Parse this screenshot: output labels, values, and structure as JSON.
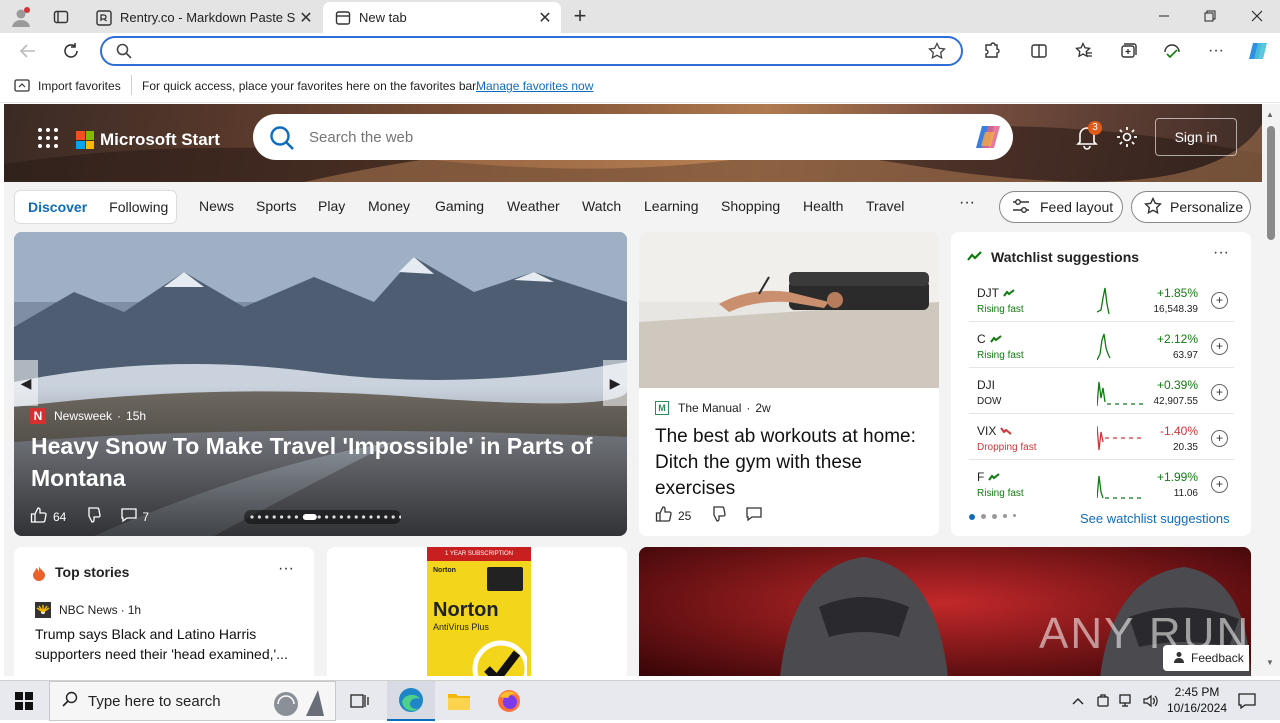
{
  "browser": {
    "tabs": [
      {
        "title": "Rentry.co - Markdown Paste Serv",
        "active": false
      },
      {
        "title": "New tab",
        "active": true
      }
    ],
    "address": {
      "value": "",
      "placeholder": ""
    },
    "favorites_bar": {
      "import_label": "Import favorites",
      "message": "For quick access, place your favorites here on the favorites bar.",
      "manage_link": "Manage favorites now"
    }
  },
  "msstart": {
    "logo_text": "Microsoft Start",
    "search_placeholder": "Search the web",
    "notification_count": "3",
    "sign_in": "Sign in",
    "discover": "Discover",
    "following": "Following",
    "nav": [
      "News",
      "Sports",
      "Play",
      "Money",
      "Gaming",
      "Weather",
      "Watch",
      "Learning",
      "Shopping",
      "Health",
      "Travel"
    ],
    "more": "···",
    "feed_layout": "Feed layout",
    "personalize": "Personalize"
  },
  "hero": {
    "source": "Newsweek",
    "time": "15h",
    "title": "Heavy Snow To Make Travel 'Impossible' in Parts of Montana",
    "likes": "64",
    "comments": "7"
  },
  "side_article": {
    "source": "The Manual",
    "time": "2w",
    "title": "The best ab workouts at home: Ditch the gym with these exercises",
    "likes": "25"
  },
  "watchlist": {
    "title": "Watchlist suggestions",
    "more": "···",
    "see_all": "See watchlist suggestions",
    "stocks": [
      {
        "symbol": "DJT",
        "status": "Rising fast",
        "change": "+1.85%",
        "price": "16,548.39",
        "dir": "up"
      },
      {
        "symbol": "C",
        "status": "Rising fast",
        "change": "+2.12%",
        "price": "63.97",
        "dir": "up"
      },
      {
        "symbol": "DJI",
        "status": "DOW",
        "change": "+0.39%",
        "price": "42,907.55",
        "dir": "up"
      },
      {
        "symbol": "VIX",
        "status": "Dropping fast",
        "change": "-1.40%",
        "price": "20.35",
        "dir": "down"
      },
      {
        "symbol": "F",
        "status": "Rising fast",
        "change": "+1.99%",
        "price": "11.06",
        "dir": "up"
      }
    ]
  },
  "top_stories": {
    "title": "Top stories",
    "source": "NBC News",
    "time": "1h",
    "headline": "Trump says Black and Latino Harris supporters need their 'head examined,'..."
  },
  "ad": {
    "brand": "Norton",
    "product": "AntiVirus Plus",
    "banner": "1 YEAR SUBSCRIPTION"
  },
  "promo": {
    "watermark": "ANY RUN",
    "feedback": "Feedback"
  },
  "taskbar": {
    "search_placeholder": "Type here to search",
    "time": "2:45 PM",
    "date": "10/16/2024"
  },
  "colors": {
    "accent": "#0f6cbd",
    "up": "#107c10",
    "down": "#d13438",
    "address_border": "#2f6fd6"
  }
}
